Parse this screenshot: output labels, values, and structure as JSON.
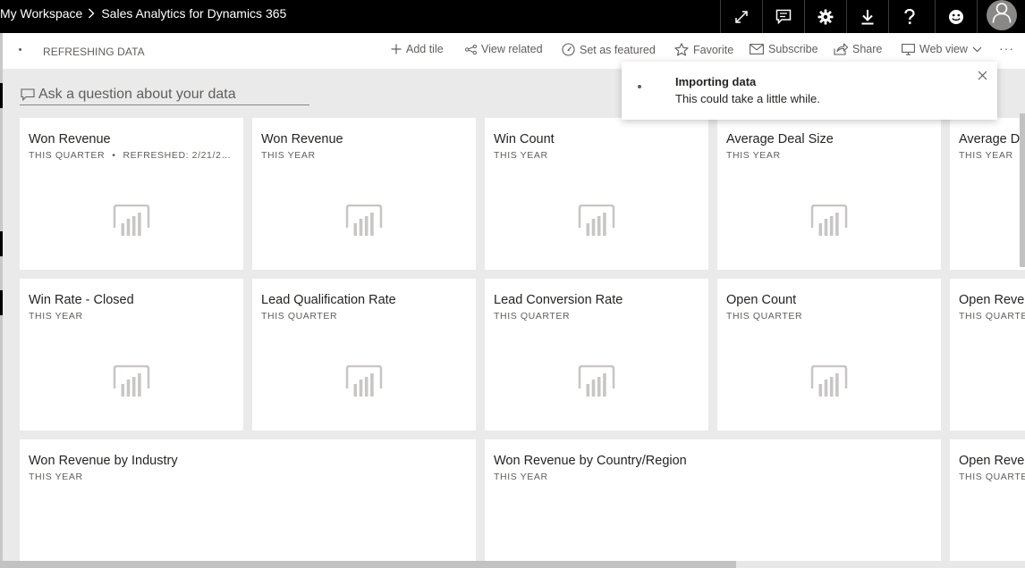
{
  "breadcrumb": {
    "workspace": "My Workspace",
    "report": "Sales Analytics for Dynamics 365"
  },
  "header_icons": [
    "expand-icon",
    "comment-icon",
    "gear-icon",
    "download-icon",
    "help-icon",
    "smiley-icon",
    "avatar-icon"
  ],
  "actionbar": {
    "status": "REFRESHING DATA",
    "add_tile": "Add tile",
    "view_related": "View related",
    "set_as_featured": "Set as featured",
    "favorite": "Favorite",
    "subscribe": "Subscribe",
    "share": "Share",
    "web_view": "Web view",
    "more": "···"
  },
  "qa": {
    "placeholder": "Ask a question about your data"
  },
  "toast": {
    "title": "Importing data",
    "message": "This could take a little while."
  },
  "tiles": [
    {
      "title": "Won Revenue",
      "subtitle": "THIS QUARTER",
      "refreshed": "REFRESHED: 2/21/2…"
    },
    {
      "title": "Won Revenue",
      "subtitle": "THIS YEAR"
    },
    {
      "title": "Win Count",
      "subtitle": "THIS YEAR"
    },
    {
      "title": "Average Deal Size",
      "subtitle": "THIS YEAR"
    },
    {
      "title": "Average D",
      "subtitle": "THIS YEAR"
    },
    {
      "title": "Win Rate - Closed",
      "subtitle": "THIS YEAR"
    },
    {
      "title": "Lead Qualification Rate",
      "subtitle": "THIS QUARTER"
    },
    {
      "title": "Lead Conversion Rate",
      "subtitle": "THIS QUARTER"
    },
    {
      "title": "Open Count",
      "subtitle": "THIS QUARTER"
    },
    {
      "title": "Open Reve",
      "subtitle": "THIS QUARTE"
    },
    {
      "title": "Won Revenue by Industry",
      "subtitle": "THIS YEAR"
    },
    {
      "title": "Won Revenue by Country/Region",
      "subtitle": "THIS YEAR"
    },
    {
      "title": "Open Reve",
      "subtitle": "THIS QUARTE"
    }
  ],
  "colors": {
    "header_bg": "#000000",
    "canvas_bg": "#eaeaea",
    "tile_bg": "#ffffff",
    "placeholder_icon": "#c8c6c4"
  }
}
